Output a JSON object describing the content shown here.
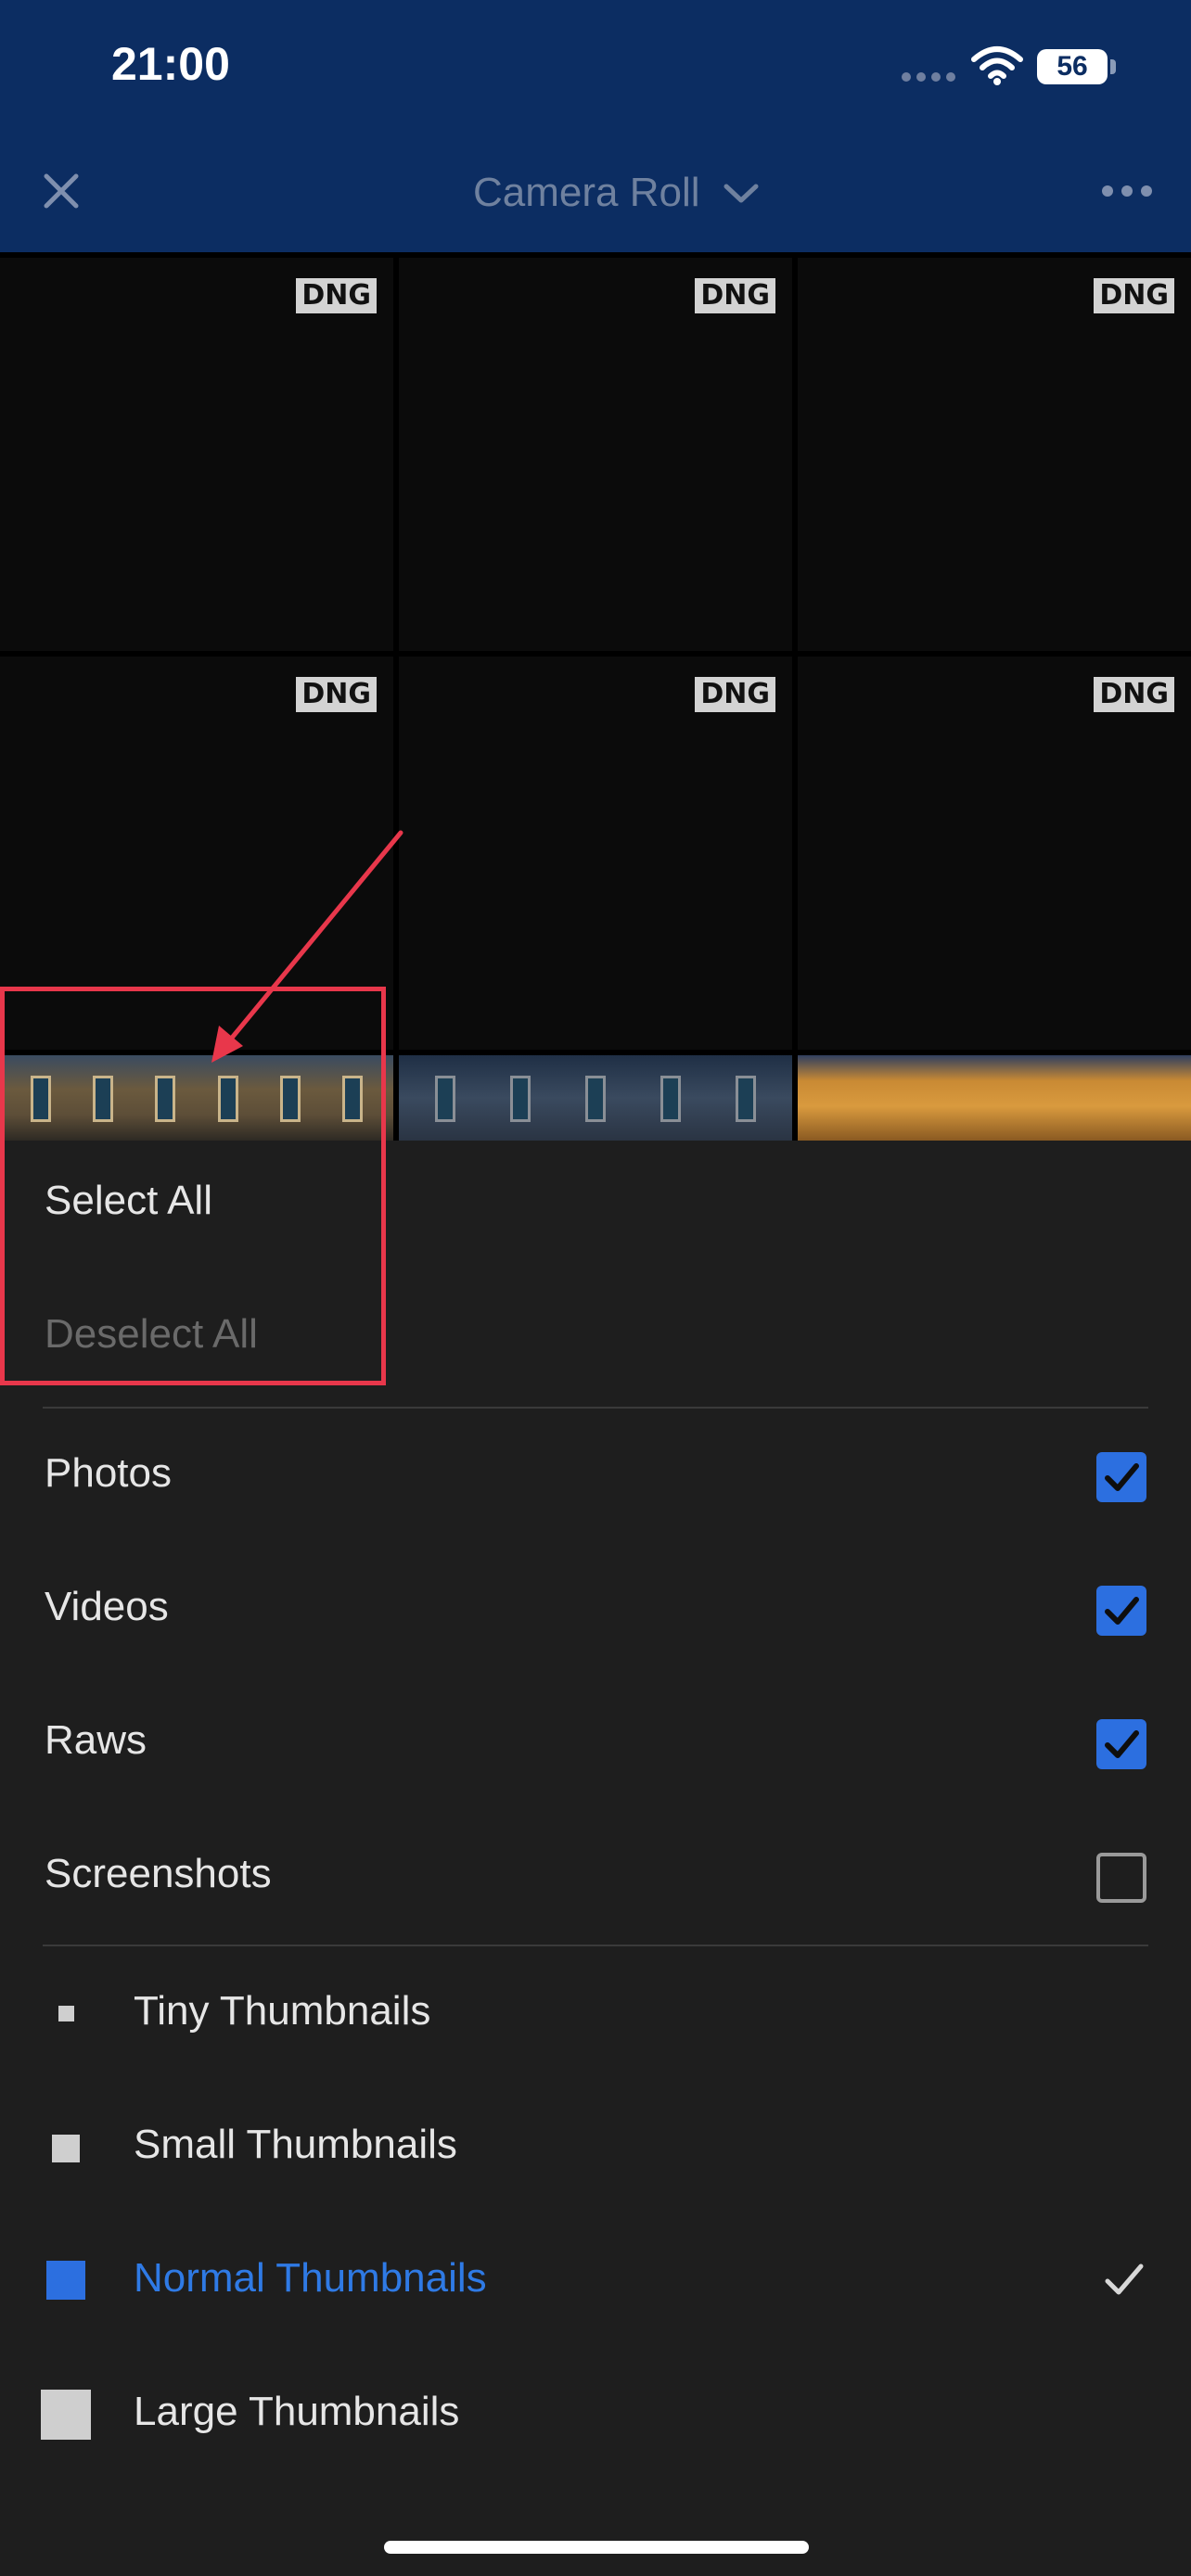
{
  "status_bar": {
    "time": "21:00",
    "battery": "56"
  },
  "header": {
    "title": "Camera Roll"
  },
  "grid": {
    "badge": "DNG"
  },
  "menu": {
    "select_all": "Select All",
    "deselect_all": "Deselect All"
  },
  "filters": [
    {
      "label": "Photos",
      "checked": true
    },
    {
      "label": "Videos",
      "checked": true
    },
    {
      "label": "Raws",
      "checked": true
    },
    {
      "label": "Screenshots",
      "checked": false
    }
  ],
  "thumbnail_sizes": [
    {
      "label": "Tiny Thumbnails",
      "selected": false
    },
    {
      "label": "Small Thumbnails",
      "selected": false
    },
    {
      "label": "Normal Thumbnails",
      "selected": true
    },
    {
      "label": "Large Thumbnails",
      "selected": false
    }
  ],
  "colors": {
    "header_bg": "#0c2d62",
    "accent": "#2c6fe0",
    "annotation": "#e8374b"
  }
}
